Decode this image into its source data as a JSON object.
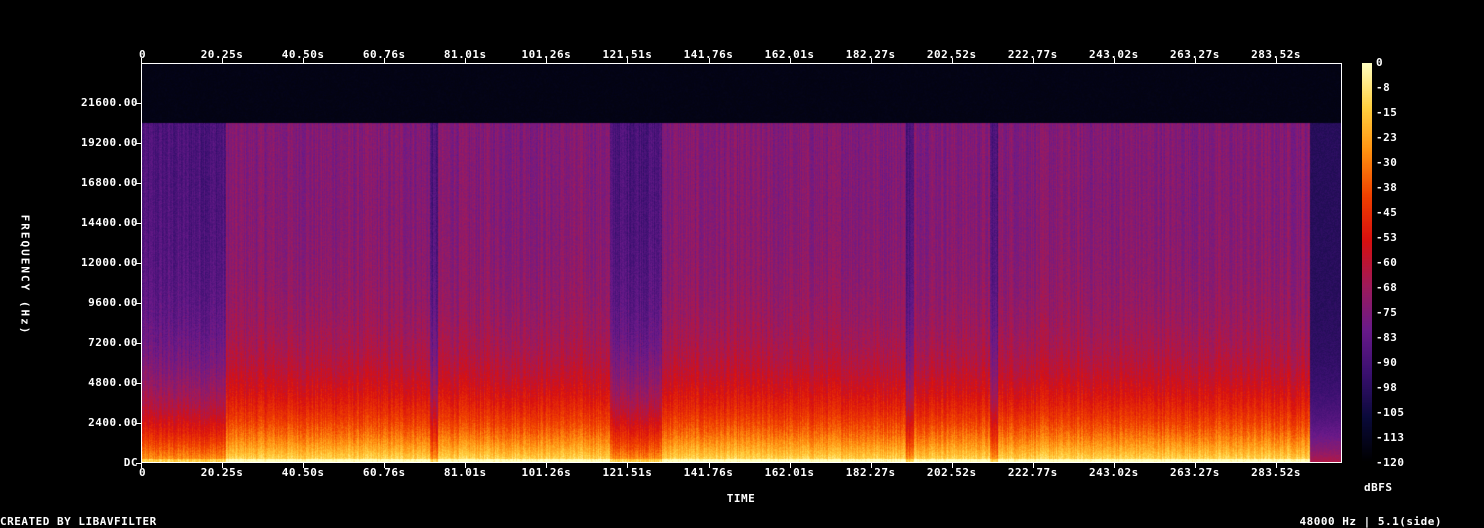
{
  "chart_data": {
    "type": "heatmap",
    "xlabel": "TIME",
    "ylabel": "FREQUENCY (Hz)",
    "x_ticks": [
      "0",
      "20.25s",
      "40.50s",
      "60.76s",
      "81.01s",
      "101.26s",
      "121.51s",
      "141.76s",
      "162.01s",
      "182.27s",
      "202.52s",
      "222.77s",
      "243.02s",
      "263.27s",
      "283.52s"
    ],
    "x_tick_values": [
      0,
      20.25,
      40.5,
      60.76,
      81.01,
      101.26,
      121.51,
      141.76,
      162.01,
      182.27,
      202.52,
      222.77,
      243.02,
      263.27,
      283.52
    ],
    "xlim": [
      0,
      300
    ],
    "y_ticks": [
      "DC",
      "2400.00",
      "4800.00",
      "7200.00",
      "9600.00",
      "12000.00",
      "14400.00",
      "16800.00",
      "19200.00",
      "21600.00"
    ],
    "y_tick_values": [
      0,
      2400,
      4800,
      7200,
      9600,
      12000,
      14400,
      16800,
      19200,
      21600
    ],
    "ylim": [
      0,
      24000
    ],
    "colorbar": {
      "label": "dBFS",
      "ticks": [
        "0",
        "-8",
        "-15",
        "-23",
        "-30",
        "-38",
        "-45",
        "-53",
        "-60",
        "-68",
        "-75",
        "-83",
        "-90",
        "-98",
        "-105",
        "-113",
        "-120"
      ],
      "range": [
        -120,
        0
      ],
      "colors": [
        "#000000",
        "#0a0a3a",
        "#3a1070",
        "#6a1a8a",
        "#a01a5a",
        "#d81010",
        "#f04000",
        "#ff9010",
        "#ffd040",
        "#ffffc0"
      ]
    },
    "signal_cutoff_hz": 20500,
    "signal_end_s": 292,
    "quiet_segments_s": [
      [
        0,
        21
      ],
      [
        72,
        74
      ],
      [
        117,
        130
      ],
      [
        191,
        193
      ],
      [
        212,
        214
      ]
    ]
  },
  "footer": {
    "left": "CREATED BY LIBAVFILTER",
    "right": "48000 Hz | 5.1(side)"
  }
}
